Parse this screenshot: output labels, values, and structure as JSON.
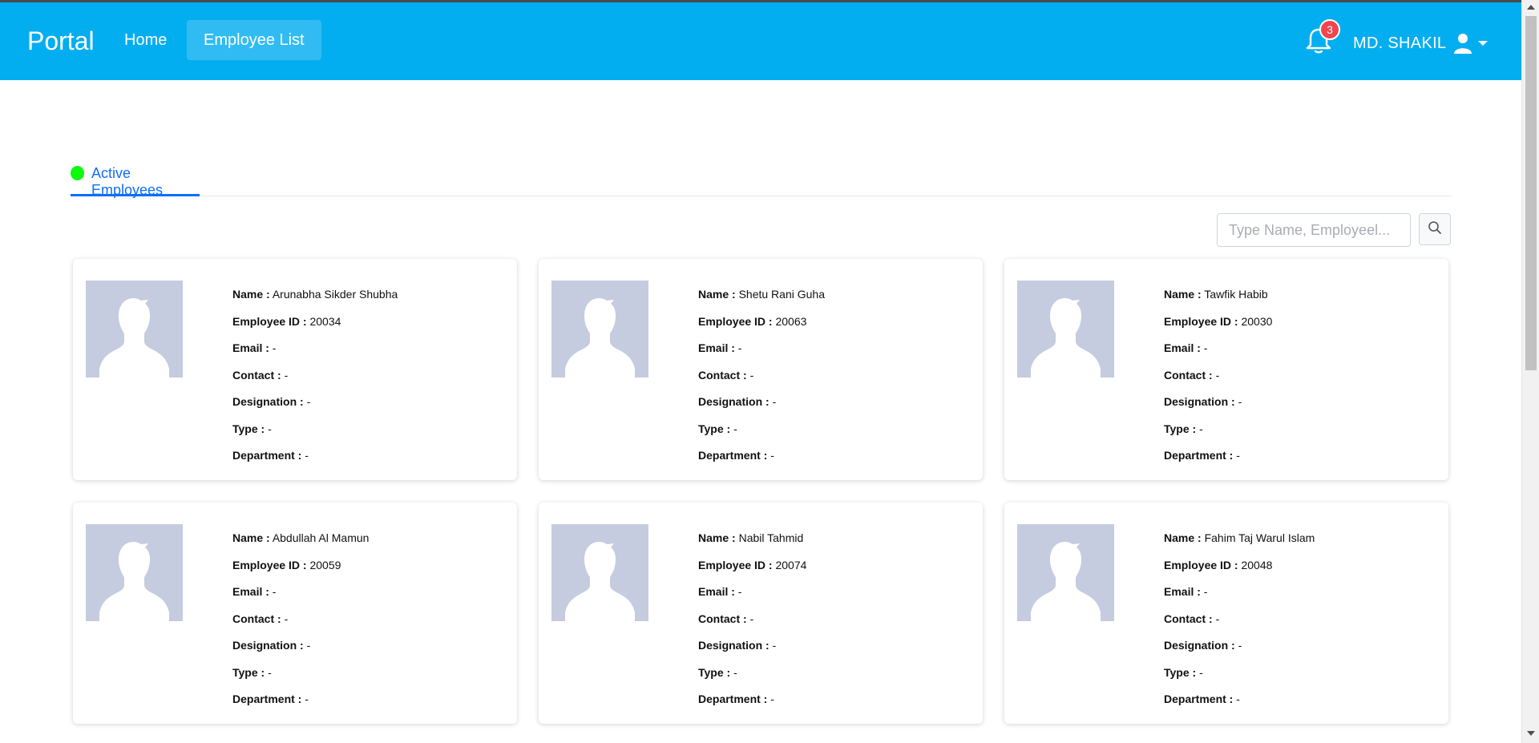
{
  "app": {
    "brand": "Portal"
  },
  "nav": {
    "home": "Home",
    "employee_list": "Employee List"
  },
  "notifications": {
    "count": "3"
  },
  "user": {
    "name": "MD. SHAKIL"
  },
  "tabs": {
    "active_employees": "Active Employees"
  },
  "search": {
    "placeholder": "Type Name, Employeel..."
  },
  "labels": {
    "name": "Name :",
    "employee_id": "Employee ID :",
    "email": "Email :",
    "contact": "Contact :",
    "designation": "Designation :",
    "type": "Type :",
    "department": "Department :"
  },
  "employees": [
    {
      "name": "Arunabha Sikder Shubha",
      "id": "20034",
      "email": "-",
      "contact": "-",
      "designation": "-",
      "type": "-",
      "department": "-"
    },
    {
      "name": "Shetu Rani Guha",
      "id": "20063",
      "email": "-",
      "contact": "-",
      "designation": "-",
      "type": "-",
      "department": "-"
    },
    {
      "name": "Tawfik Habib",
      "id": "20030",
      "email": "-",
      "contact": "-",
      "designation": "-",
      "type": "-",
      "department": "-"
    },
    {
      "name": "Abdullah Al Mamun",
      "id": "20059",
      "email": "-",
      "contact": "-",
      "designation": "-",
      "type": "-",
      "department": "-"
    },
    {
      "name": "Nabil Tahmid",
      "id": "20074",
      "email": "-",
      "contact": "-",
      "designation": "-",
      "type": "-",
      "department": "-"
    },
    {
      "name": "Fahim Taj Warul Islam",
      "id": "20048",
      "email": "-",
      "contact": "-",
      "designation": "-",
      "type": "-",
      "department": "-"
    }
  ],
  "colors": {
    "navbar": "#03aef0",
    "accent": "#0d6efd",
    "status_active": "#0df90d",
    "badge": "#f0454f",
    "avatar_bg": "#c5cce0"
  }
}
